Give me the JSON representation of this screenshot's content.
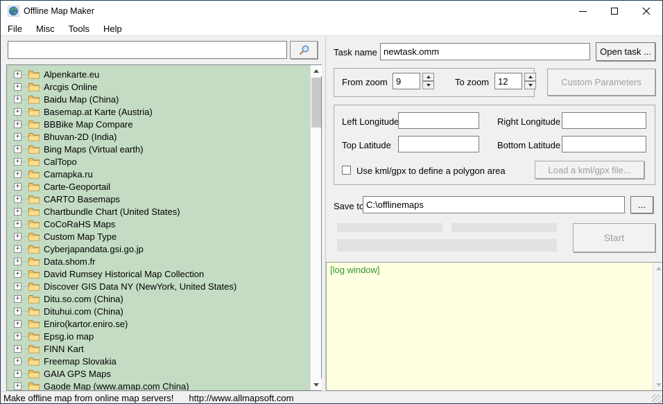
{
  "window": {
    "title": "Offline Map Maker"
  },
  "menu": {
    "items": [
      "File",
      "Misc",
      "Tools",
      "Help"
    ]
  },
  "search": {
    "value": ""
  },
  "tree": {
    "expand_glyph": "+",
    "items": [
      "Alpenkarte.eu",
      "Arcgis Online",
      "Baidu Map (China)",
      "Basemap.at Karte (Austria)",
      "BBBike Map Compare",
      "Bhuvan-2D (India)",
      "Bing Maps (Virtual earth)",
      "CalTopo",
      "Camapka.ru",
      "Carte-Geoportail",
      "CARTO Basemaps",
      "Chartbundle Chart (United States)",
      "CoCoRaHS Maps",
      "Custom Map Type",
      "Cyberjapandata.gsi.go.jp",
      "Data.shom.fr",
      "David Rumsey Historical Map Collection",
      "Discover GIS Data NY (NewYork, United States)",
      "Ditu.so.com (China)",
      "Dituhui.com (China)",
      "Eniro(kartor.eniro.se)",
      "Epsg.io map",
      "FINN Kart",
      "Freemap Slovakia",
      "GAIA GPS Maps",
      "Gaode Map (www.amap.com China)"
    ]
  },
  "task": {
    "label": "Task name",
    "value": "newtask.omm",
    "open_button": "Open task ..."
  },
  "zoom_box": {
    "from_label": "From zoom",
    "from_value": "9",
    "to_label": "To zoom",
    "to_value": "12"
  },
  "custom_parameters_button": "Custom Parameters",
  "area": {
    "left_longitude_label": "Left Longitude",
    "right_longitude_label": "Right Longitude",
    "top_latitude_label": "Top Latitude",
    "bottom_latitude_label": "Bottom Latitude",
    "left_longitude_value": "",
    "right_longitude_value": "",
    "top_latitude_value": "",
    "bottom_latitude_value": "",
    "kml_checkbox_label": "Use kml/gpx to define a polygon area",
    "kml_checked": false,
    "load_kml_button": "Load a kml/gpx file..."
  },
  "save": {
    "label": "Save to:",
    "path": "C:\\offlinemaps",
    "browse_button": "..."
  },
  "start_button": "Start",
  "log": {
    "content": "[log window]"
  },
  "status_bar": {
    "message": "Make offline map from online map servers!",
    "url": "http://www.allmapsoft.com"
  },
  "colors": {
    "tree_bg": "#c4dcc4",
    "log_bg": "#ffffe1",
    "log_text": "#2e9b2e",
    "window_bg": "#f0f0f0",
    "titlebar_bg": "#ffffff"
  }
}
